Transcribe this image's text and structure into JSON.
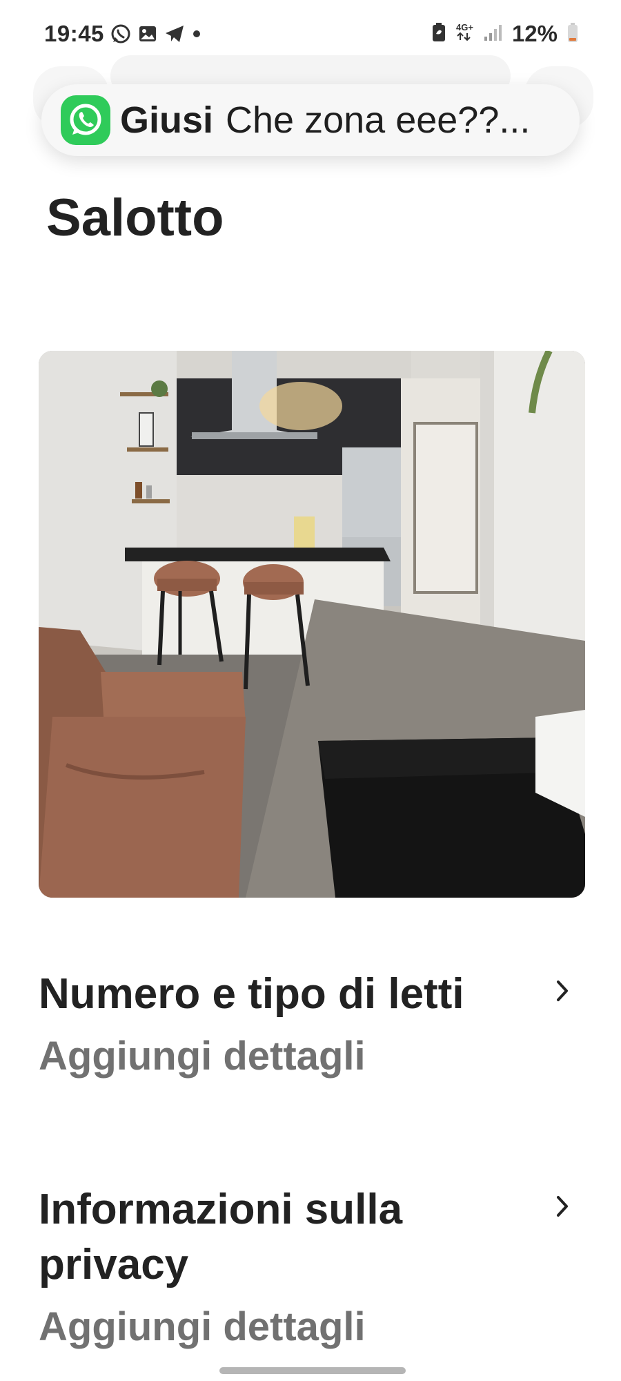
{
  "status_bar": {
    "time": "19:45",
    "network": "4G+",
    "battery": "12%",
    "left_icons": [
      "whatsapp-icon",
      "gallery-icon",
      "telegram-icon",
      "dot-icon"
    ],
    "right_icons": [
      "battery-saver-icon",
      "network-4g-icon",
      "signal-icon",
      "battery-icon"
    ]
  },
  "notification": {
    "app_icon": "whatsapp-icon",
    "sender": "Giusi",
    "message": "Che zona eee??...",
    "accent_color": "#2fcb5a"
  },
  "page": {
    "title": "Salotto",
    "photo_icon": "room-photo"
  },
  "rows": [
    {
      "title": "Numero e tipo di letti",
      "subtitle": "Aggiungi dettagli",
      "icon": "chevron-right-icon"
    },
    {
      "title": "Informazioni sulla privacy",
      "subtitle": "Aggiungi dettagli",
      "icon": "chevron-right-icon"
    }
  ],
  "colors": {
    "text_primary": "#222222",
    "text_secondary": "#717171",
    "background": "#ffffff"
  }
}
